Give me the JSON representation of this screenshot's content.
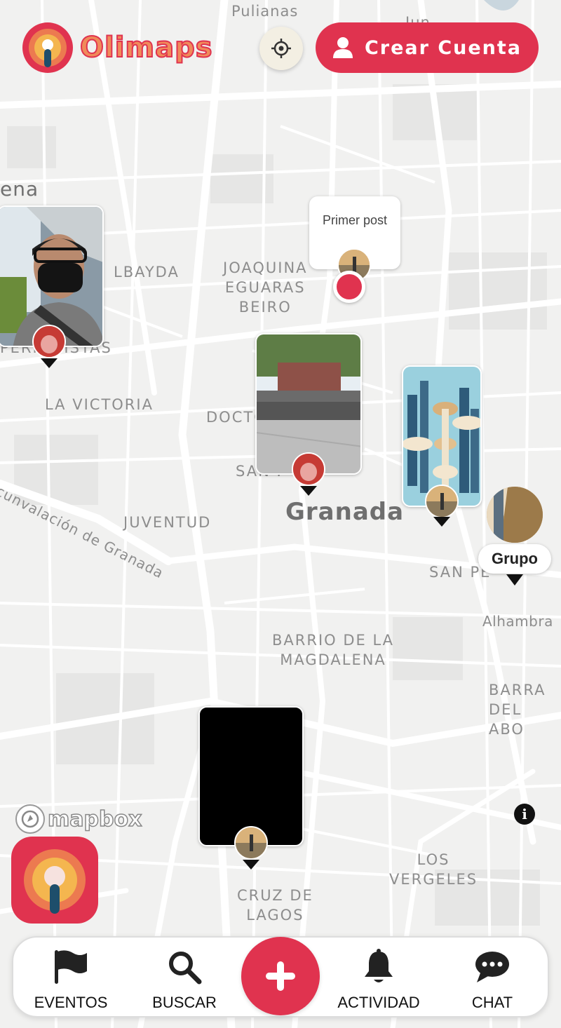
{
  "app": {
    "brand_name": "Olimaps",
    "create_account_label": "Crear Cuenta"
  },
  "map": {
    "labels": {
      "pulianas": "Pulianas",
      "jun": "Jun",
      "ena": "ena",
      "albayda": "LBAYDA",
      "joaquina": "JOAQUINA\nEGUARAS\nBEIRO",
      "periodistas": "PERIODISTAS",
      "la_victoria": "LA VICTORIA",
      "doctores": "DOCTO",
      "san_pablo": "SAN F",
      "granada": "Granada",
      "circunvalacion": "cunvalación de Granada",
      "juventud": "JUVENTUD",
      "san_pedro": "SAN PE",
      "alhambra": "Alhambra",
      "magdalena": "BARRIO DE LA\nMAGDALENA",
      "barranco": "BARRA\nDEL ABO",
      "los_vergeles": "LOS\nVERGELES",
      "cruz_de_lagos": "CRUZ DE\nLAGOS"
    },
    "note_post_text": "Primer post",
    "group_label": "Grupo",
    "attribution": "mapbox",
    "info_symbol": "i"
  },
  "nav": {
    "eventos": "EVENTOS",
    "buscar": "BUSCAR",
    "actividad": "ACTIVIDAD",
    "chat": "CHAT"
  },
  "icons": {
    "brand": "olimaps-logo-icon",
    "locate": "crosshair-icon",
    "user": "user-icon",
    "flag": "flag-icon",
    "search": "search-icon",
    "add": "plus-icon",
    "bell": "bell-icon",
    "chat": "chat-bubble-icon",
    "info": "info-icon"
  },
  "colors": {
    "accent": "#e0334f",
    "orange": "#ec7a50",
    "yellow": "#f4b64f",
    "navy": "#1e4e6b",
    "map_bg": "#f1f1f0",
    "road": "#ffffff"
  }
}
